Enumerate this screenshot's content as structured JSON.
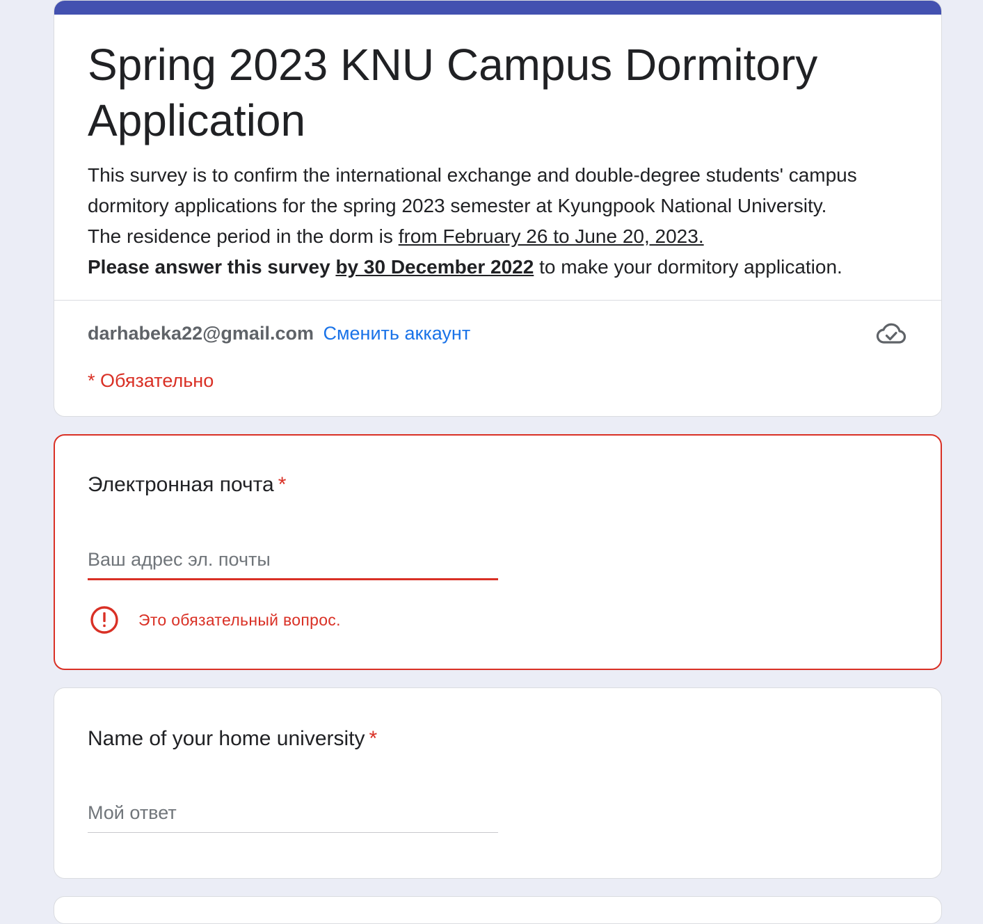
{
  "header": {
    "title": "Spring 2023 KNU Campus Dormitory Application",
    "description_line1": "This survey is to confirm the international exchange and double-degree students' campus dormitory applications for the spring 2023 semester at Kyungpook National University.",
    "residence_prefix": "The residence period in the dorm is ",
    "residence_period": "from February 26 to June 20, 2023.",
    "deadline_prefix": "Please answer this survey ",
    "deadline_date": "by 30 December 2022",
    "deadline_suffix": " to make your dormitory application.",
    "accent_color": "#4351b0"
  },
  "account": {
    "email": "darhabeka22@gmail.com",
    "switch_label": "Сменить аккаунт",
    "saved_icon": "cloud-check-icon"
  },
  "required_note": "* Обязательно",
  "questions": [
    {
      "title": "Электронная почта",
      "required_mark": "*",
      "placeholder": "Ваш адрес эл. почты",
      "value": "",
      "error": "Это обязательный вопрос.",
      "error_icon": "alert-circle-icon"
    },
    {
      "title": "Name of your home university",
      "required_mark": "*",
      "placeholder": "Мой ответ",
      "value": ""
    }
  ],
  "colors": {
    "error": "#d93025",
    "link": "#1a73e8",
    "background": "#ebedf6"
  }
}
